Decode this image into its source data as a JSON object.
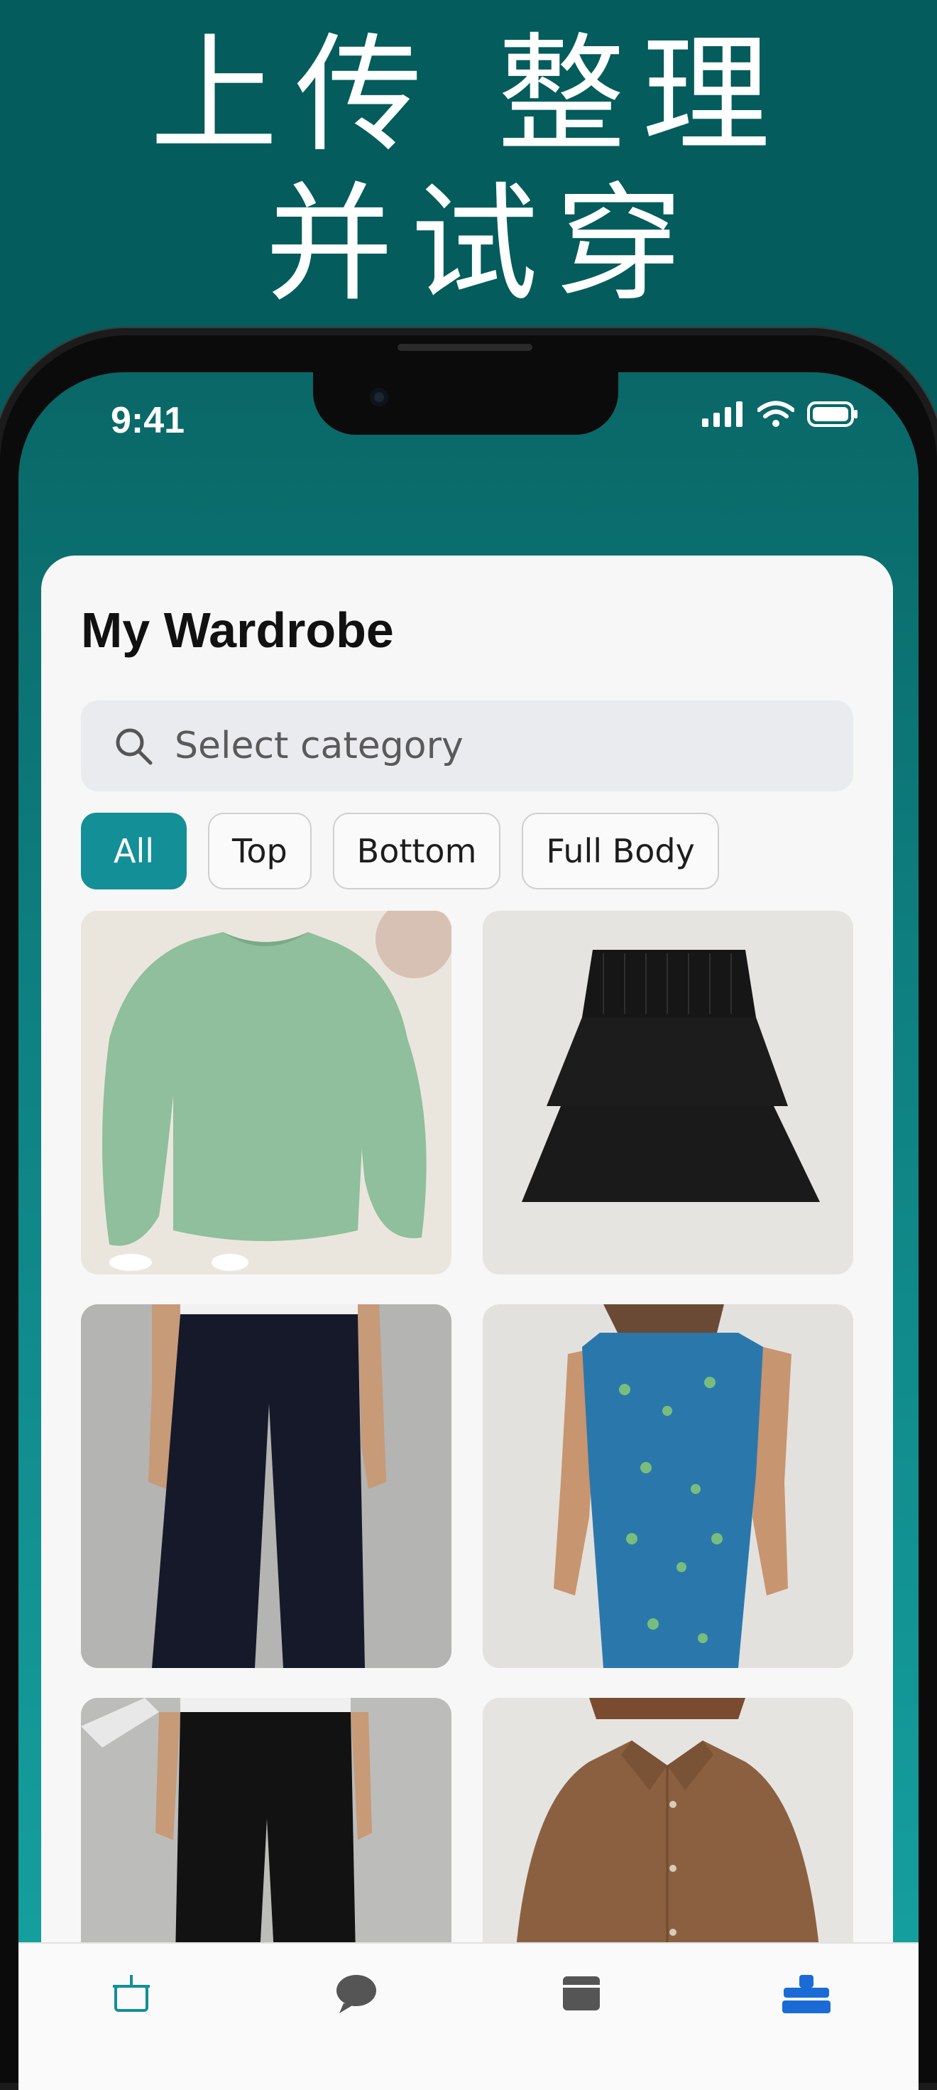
{
  "headline": {
    "line1": "上传 整理",
    "line2": "并试穿"
  },
  "status_bar": {
    "time": "9:41"
  },
  "wardrobe": {
    "title": "My Wardrobe",
    "search": {
      "placeholder": "Select category"
    },
    "filters": [
      "All",
      "Top",
      "Bottom",
      "Full Body"
    ],
    "active_filter": "All",
    "items": [
      {
        "name": "mint-green-sweatshirt"
      },
      {
        "name": "black-tiered-skirt"
      },
      {
        "name": "navy-wide-leg-trousers"
      },
      {
        "name": "blue-floral-dress"
      },
      {
        "name": "black-pleated-trousers"
      },
      {
        "name": "brown-button-shirt"
      }
    ]
  },
  "tab_bar": {
    "tabs": [
      {
        "icon": "hanger-bag-icon"
      },
      {
        "icon": "chat-bubble-icon"
      },
      {
        "icon": "wardrobe-box-icon"
      },
      {
        "icon": "closet-icon",
        "active": true
      }
    ]
  },
  "colors": {
    "accent": "#138f97",
    "background": "#045c5c"
  }
}
